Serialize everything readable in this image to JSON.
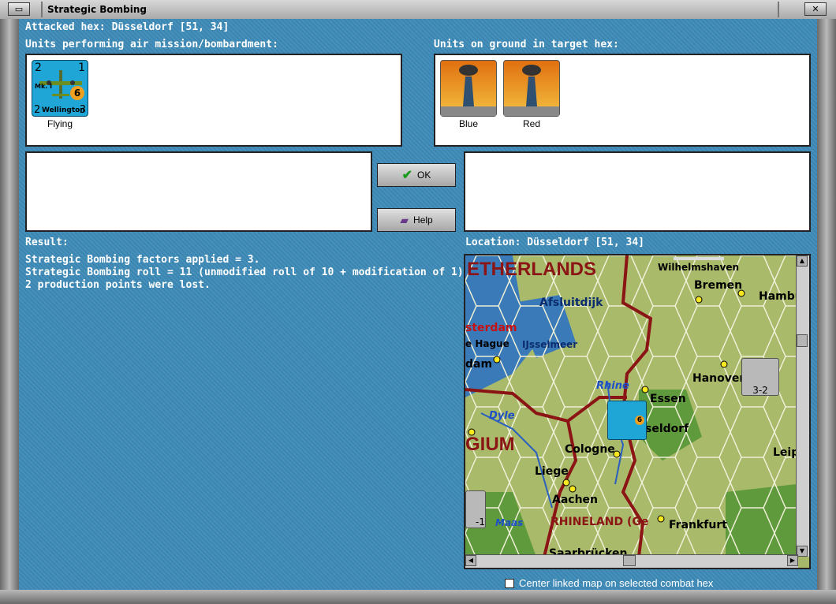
{
  "window": {
    "title": "Strategic Bombing"
  },
  "header": {
    "attacked_hex": "Attacked hex: Düsseldorf  [51, 34]"
  },
  "air_units": {
    "label": "Units performing air mission/bombardment:",
    "items": [
      {
        "name": "Wellington",
        "status": "Flying",
        "tl": "2",
        "tr": "1",
        "bl": "2",
        "br": "3",
        "mark": "Mk. I",
        "value": "6",
        "icon": "bomber-aircraft-icon"
      }
    ]
  },
  "ground_units": {
    "label": "Units on ground in target hex:",
    "items": [
      {
        "label": "Blue",
        "icon": "factory-icon"
      },
      {
        "label": "Red",
        "icon": "factory-icon"
      }
    ]
  },
  "buttons": {
    "ok": "OK",
    "help": "Help"
  },
  "result": {
    "label": "Result:",
    "lines": [
      "Strategic Bombing factors applied = 3.",
      "Strategic Bombing roll = 11 (unmodified roll of 10 + modification of 1).",
      "2 production points were lost."
    ]
  },
  "location": {
    "label": "Location:  Düsseldorf  [51, 34]",
    "map_labels": {
      "netherlands": "ETHERLANDS",
      "wilhelmshaven": "Wilhelmshaven",
      "bremen": "Bremen",
      "hamburg": "Hambu",
      "afsluitdijk": "Afsluitdijk",
      "amsterdam": "sterdam",
      "hague": "e Hague",
      "ijsselmeer": "IJsselmeer",
      "rotterdam": "dam",
      "hanover": "Hanover",
      "rhine": "Rhine",
      "essen": "Essen",
      "dyle": "Dyle",
      "dusseldorf": "seldorf",
      "belgium": "GIUM",
      "cologne": "Cologne",
      "leipzig": "Leip",
      "liege": "Liege",
      "aachen": "Aachen",
      "maas": "Maas",
      "rhineland": "RHINELAND (Ge",
      "frankfurt": "Frankfurt",
      "saarbrucken": "Saarbrücken",
      "army_unit": "3-2",
      "army_unit_left": "-1"
    }
  },
  "options": {
    "center_map": "Center linked map on selected combat hex"
  },
  "colors": {
    "background": "#3d8ab8",
    "counter": "#1fa6d6",
    "accent_red": "#8b1414"
  }
}
